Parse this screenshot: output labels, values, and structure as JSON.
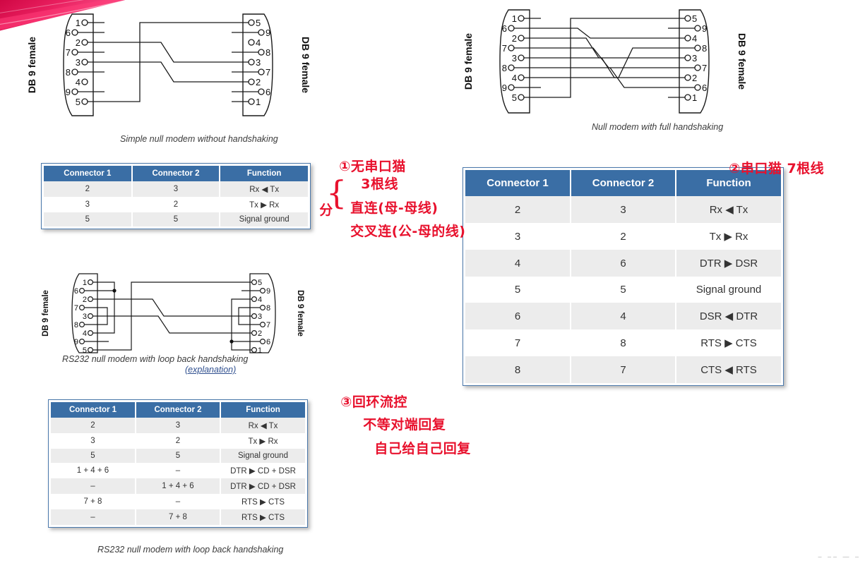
{
  "page": {
    "background_color": "#ffffff",
    "accent_blue": "#3a6ea5",
    "annotation_red": "#e8112d",
    "swoosh_color": "#e8215a"
  },
  "diagrams": [
    {
      "id": "simple-null-modem",
      "caption": "Simple null modem without handshaking",
      "left_connector_label": "DB 9 female",
      "right_connector_label": "DB 9 female",
      "left_pins": [
        "1",
        "6",
        "2",
        "7",
        "3",
        "8",
        "4",
        "9",
        "5"
      ],
      "right_pins": [
        "5",
        "9",
        "4",
        "8",
        "3",
        "7",
        "2",
        "6",
        "1"
      ],
      "connections": [
        {
          "from": "2",
          "to": "3"
        },
        {
          "from": "3",
          "to": "2"
        },
        {
          "from": "5",
          "to": "5"
        }
      ]
    },
    {
      "id": "full-handshaking",
      "caption": "Null modem with full handshaking",
      "left_connector_label": "DB 9 female",
      "right_connector_label": "DB 9 female",
      "left_pins": [
        "1",
        "6",
        "2",
        "7",
        "3",
        "8",
        "4",
        "9",
        "5"
      ],
      "right_pins": [
        "5",
        "9",
        "4",
        "8",
        "3",
        "7",
        "2",
        "6",
        "1"
      ],
      "connections": [
        {
          "from": "2",
          "to": "3"
        },
        {
          "from": "3",
          "to": "2"
        },
        {
          "from": "4",
          "to": "6"
        },
        {
          "from": "5",
          "to": "5"
        },
        {
          "from": "6",
          "to": "4"
        },
        {
          "from": "7",
          "to": "8"
        },
        {
          "from": "8",
          "to": "7"
        }
      ]
    },
    {
      "id": "loop-back-handshaking",
      "caption": "RS232 null modem with loop back handshaking",
      "caption_link": "(explanation)",
      "left_connector_label": "DB 9 female",
      "right_connector_label": "DB 9 female",
      "left_pins": [
        "1",
        "6",
        "2",
        "7",
        "3",
        "8",
        "4",
        "9",
        "5"
      ],
      "right_pins": [
        "5",
        "9",
        "4",
        "8",
        "3",
        "7",
        "2",
        "6",
        "1"
      ],
      "connections": [
        {
          "from": "2",
          "to": "3"
        },
        {
          "from": "3",
          "to": "2"
        },
        {
          "from": "5",
          "to": "5"
        }
      ],
      "loopbacks": [
        "1+4+6",
        "7+8"
      ]
    }
  ],
  "tables": [
    {
      "id": "table-simple",
      "headers": [
        "Connector 1",
        "Connector 2",
        "Function"
      ],
      "rows": [
        [
          "2",
          "3",
          "Rx ◀ Tx"
        ],
        [
          "3",
          "2",
          "Tx ▶ Rx"
        ],
        [
          "5",
          "5",
          "Signal ground"
        ]
      ]
    },
    {
      "id": "table-full-handshaking",
      "headers": [
        "Connector 1",
        "Connector 2",
        "Function"
      ],
      "rows": [
        [
          "2",
          "3",
          "Rx ◀ Tx"
        ],
        [
          "3",
          "2",
          "Tx ▶ Rx"
        ],
        [
          "4",
          "6",
          "DTR ▶ DSR"
        ],
        [
          "5",
          "5",
          "Signal ground"
        ],
        [
          "6",
          "4",
          "DSR ◀ DTR"
        ],
        [
          "7",
          "8",
          "RTS ▶ CTS"
        ],
        [
          "8",
          "7",
          "CTS ◀ RTS"
        ]
      ]
    },
    {
      "id": "table-loop-back",
      "headers": [
        "Connector 1",
        "Connector 2",
        "Function"
      ],
      "rows": [
        [
          "2",
          "3",
          "Rx ◀ Tx"
        ],
        [
          "3",
          "2",
          "Tx ▶ Rx"
        ],
        [
          "5",
          "5",
          "Signal ground"
        ],
        [
          "1 + 4 + 6",
          "–",
          "DTR ▶ CD + DSR"
        ],
        [
          "–",
          "1 + 4 + 6",
          "DTR ▶ CD + DSR"
        ],
        [
          "7 + 8",
          "–",
          "RTS ▶ CTS"
        ],
        [
          "–",
          "7 + 8",
          "RTS ▶ CTS"
        ]
      ]
    }
  ],
  "captions": {
    "bottom_repeat": "RS232 null modem with loop back handshaking"
  },
  "annotations": [
    {
      "id": "annotation-1",
      "marker": "①",
      "lines": [
        "无串口猫",
        "3根线"
      ],
      "prefix": "分",
      "branch_lines": [
        "直连(母-母线)",
        "交叉连(公-母的线)"
      ]
    },
    {
      "id": "annotation-2",
      "marker": "②",
      "lines": [
        "串口猫 7根线"
      ]
    },
    {
      "id": "annotation-3",
      "marker": "③",
      "lines": [
        "回环流控",
        "不等对端回复",
        "自己给自己回复"
      ]
    }
  ],
  "footer": {
    "smudge": "– –– — –"
  }
}
